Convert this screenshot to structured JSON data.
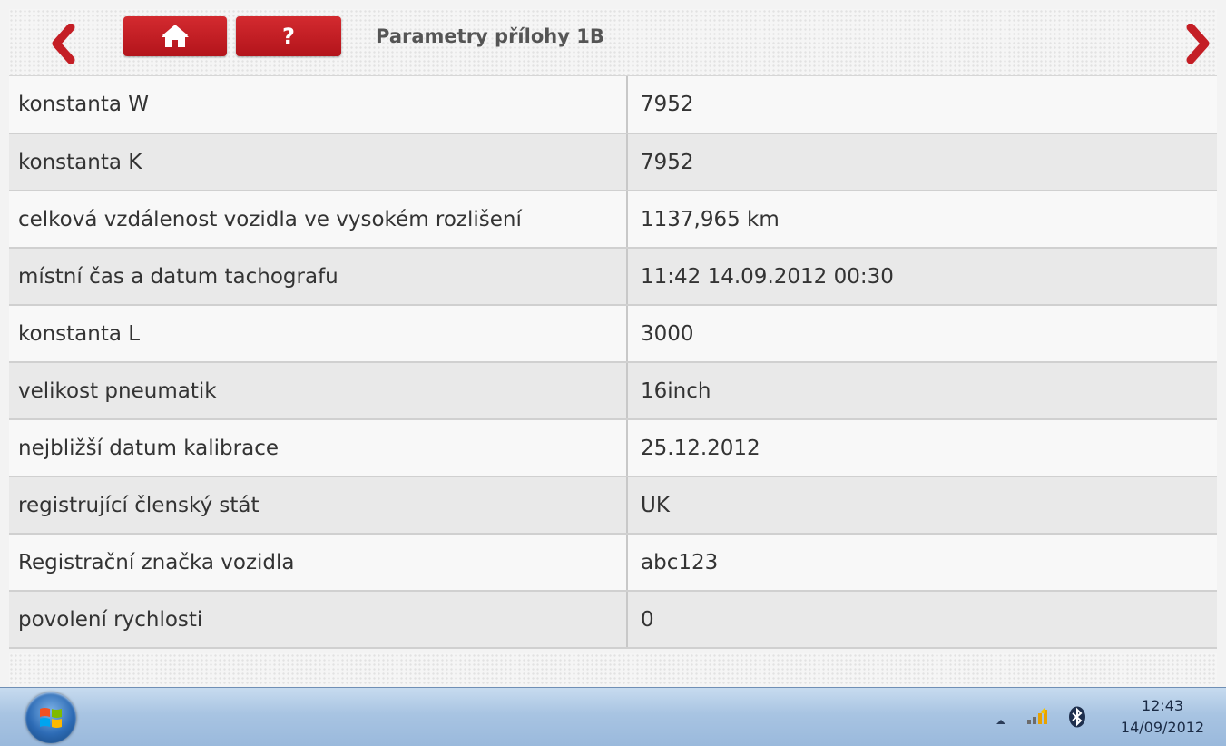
{
  "header": {
    "title": "Parametry přílohy 1B",
    "back_icon": "chevron-left-icon",
    "forward_icon": "chevron-right-icon",
    "home_icon": "home-icon",
    "help_label": "?"
  },
  "colors": {
    "accent_red": "#c41e25",
    "taskbar_blue": "#a8c4e2"
  },
  "parameters": [
    {
      "label": "konstanta W",
      "value": "7952"
    },
    {
      "label": "konstanta K",
      "value": "7952"
    },
    {
      "label": "celková vzdálenost vozidla ve vysokém rozlišení",
      "value": "1137,965 km"
    },
    {
      "label": "místní čas a datum tachografu",
      "value": "11:42 14.09.2012 00:30"
    },
    {
      "label": "konstanta L",
      "value": "3000"
    },
    {
      "label": "velikost pneumatik",
      "value": "16inch"
    },
    {
      "label": "nejbližší datum kalibrace",
      "value": "25.12.2012"
    },
    {
      "label": "registrující členský stát",
      "value": "UK"
    },
    {
      "label": "Registrační značka vozidla",
      "value": "abc123"
    },
    {
      "label": "povolení rychlosti",
      "value": "0"
    }
  ],
  "taskbar": {
    "start_icon": "windows-start-icon",
    "tray_icons": [
      "tray-expand-icon",
      "signal-icon",
      "bluetooth-icon"
    ],
    "clock_time": "12:43",
    "clock_date": "14/09/2012"
  }
}
